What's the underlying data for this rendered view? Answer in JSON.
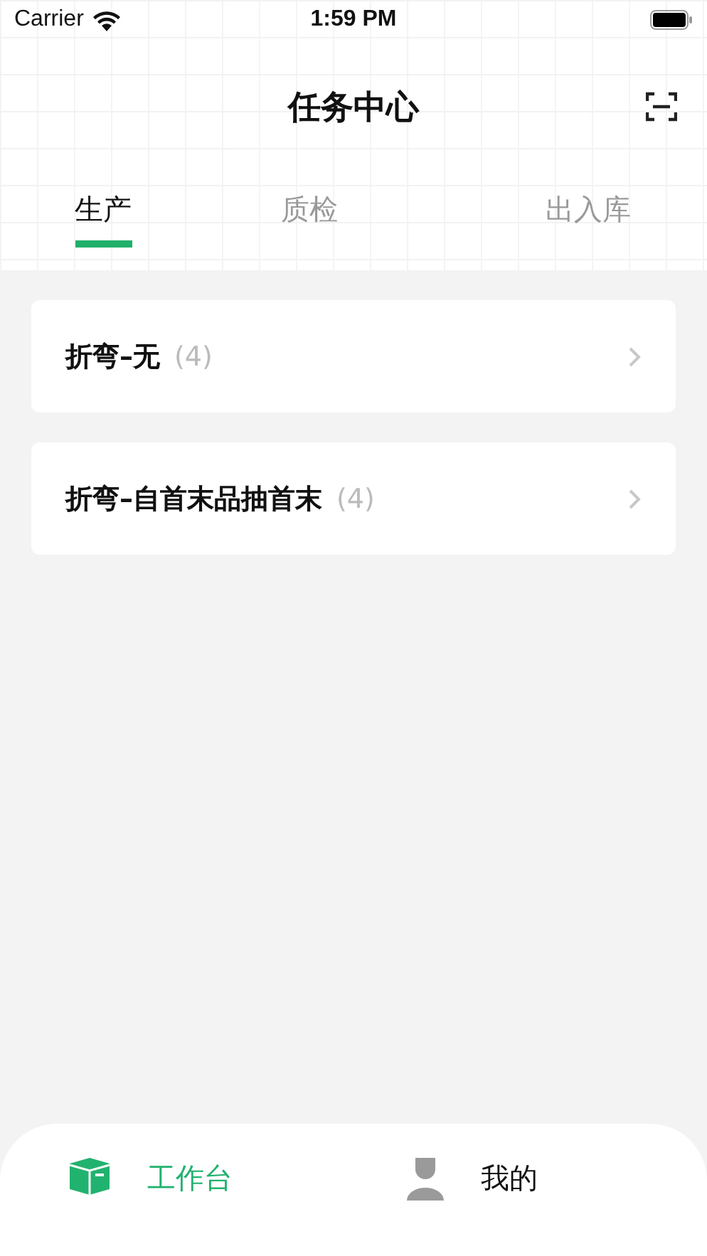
{
  "status_bar": {
    "carrier": "Carrier",
    "time": "1:59 PM"
  },
  "header": {
    "title": "任务中心"
  },
  "tabs": [
    {
      "label": "生产",
      "selected": true
    },
    {
      "label": "质检",
      "selected": false
    },
    {
      "label": "出入库",
      "selected": false
    }
  ],
  "tasks": [
    {
      "name": "折弯–无",
      "count": "(4)"
    },
    {
      "name": "折弯–自首末品抽首末",
      "count": "(4)"
    }
  ],
  "bottom_nav": [
    {
      "label": "工作台",
      "kind": "box",
      "selected": true
    },
    {
      "label": "我的",
      "kind": "person",
      "selected": false
    }
  ]
}
